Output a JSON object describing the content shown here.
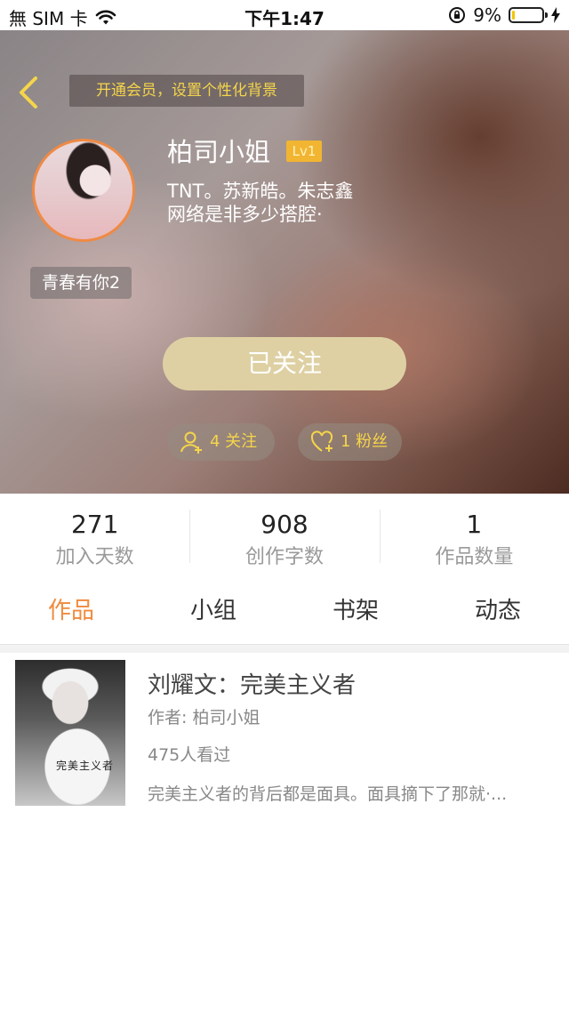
{
  "status_bar": {
    "carrier": "無 SIM 卡",
    "time": "下午1:47",
    "battery_percent": "9%",
    "battery_level": 0.09,
    "icons": [
      "wifi-icon",
      "orientation-lock-icon",
      "battery-icon",
      "charging-icon"
    ]
  },
  "header": {
    "vip_banner": "开通会员，设置个性化背景",
    "username": "柏司小姐",
    "level": "Lv1",
    "bio_line1": "TNT。苏新皓。朱志鑫",
    "bio_line2": "网络是非多少搭腔·",
    "avatar_tag": "青春有你2",
    "follow_button": "已关注",
    "following": "4 关注",
    "fans": "1 粉丝"
  },
  "stats": [
    {
      "value": "271",
      "label": "加入天数"
    },
    {
      "value": "908",
      "label": "创作字数"
    },
    {
      "value": "1",
      "label": "作品数量"
    }
  ],
  "tabs": [
    {
      "label": "作品",
      "active": true
    },
    {
      "label": "小组",
      "active": false
    },
    {
      "label": "书架",
      "active": false
    },
    {
      "label": "动态",
      "active": false
    }
  ],
  "work": {
    "title": "刘耀文：完美主义者",
    "author": "作者: 柏司小姐",
    "views": "475人看过",
    "description": "完美主义者的背后都是面具。面具摘下了那就·...",
    "cover_text": "完美主义者"
  },
  "colors": {
    "accent": "#f08a3c",
    "gold": "#f5d54a",
    "follow_button": "#ded0a3",
    "level_badge": "#f2b531",
    "avatar_ring": "#ef8a45"
  }
}
